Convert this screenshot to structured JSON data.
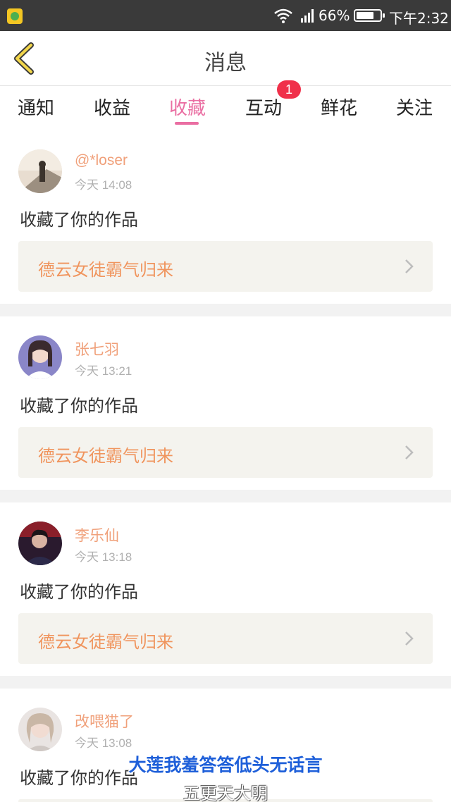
{
  "status_bar": {
    "battery_percent": "66%",
    "time": "下午2:32"
  },
  "header": {
    "title": "消息"
  },
  "tabs": [
    {
      "label": "通知",
      "active": false
    },
    {
      "label": "收益",
      "active": false
    },
    {
      "label": "收藏",
      "active": true
    },
    {
      "label": "互动",
      "active": false,
      "badge": "1"
    },
    {
      "label": "鲜花",
      "active": false
    },
    {
      "label": "关注",
      "active": false
    }
  ],
  "colors": {
    "accent": "#ea6ea2",
    "username": "#f0a07a",
    "work_title": "#f0955e",
    "badge": "#f0304a"
  },
  "messages": [
    {
      "user": "@*loser",
      "time": "今天 14:08",
      "action": "收藏了你的作品",
      "work": "德云女徒霸气归来"
    },
    {
      "user": "张七羽",
      "time": "今天 13:21",
      "action": "收藏了你的作品",
      "work": "德云女徒霸气归来"
    },
    {
      "user": "李乐仙",
      "time": "今天 13:18",
      "action": "收藏了你的作品",
      "work": "德云女徒霸气归来"
    },
    {
      "user": "改喂猫了",
      "time": "今天 13:08",
      "action": "收藏了你的作品",
      "work": ""
    }
  ],
  "subtitles": {
    "main": "大莲我羞答答低头无话言",
    "sub": "五更天大明"
  }
}
